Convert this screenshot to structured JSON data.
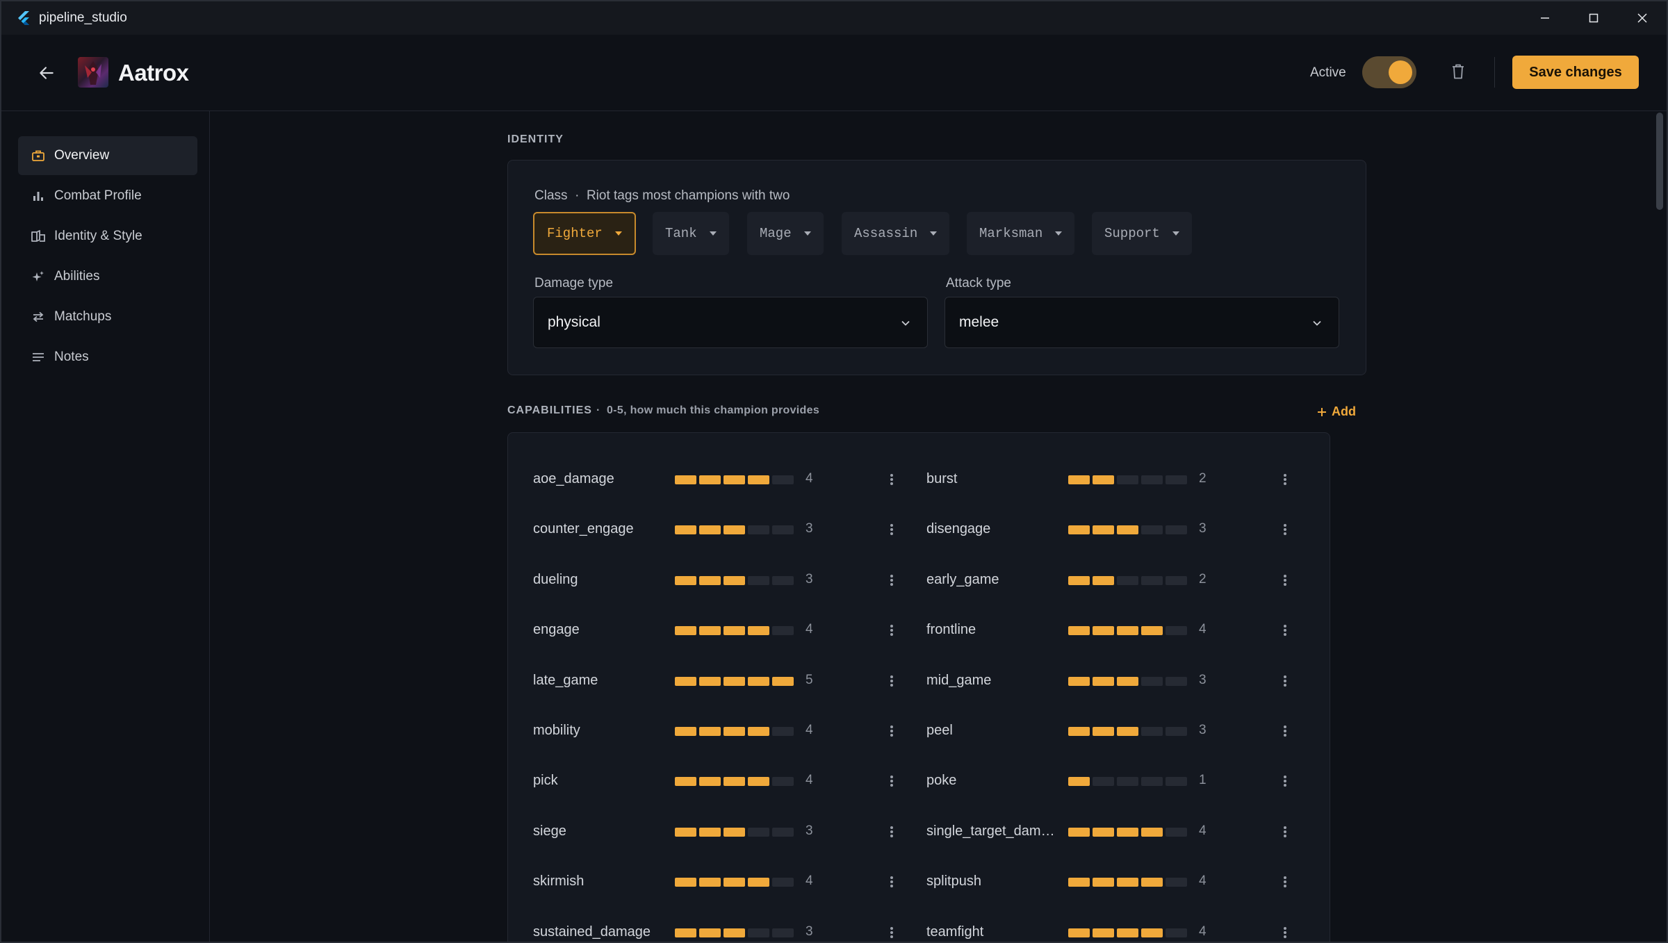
{
  "window": {
    "title": "pipeline_studio"
  },
  "header": {
    "champion_name": "Aatrox",
    "active_label": "Active",
    "active": true,
    "save_label": "Save changes"
  },
  "sidebar": {
    "items": [
      {
        "label": "Overview",
        "icon": "briefcase-icon",
        "active": true
      },
      {
        "label": "Combat Profile",
        "icon": "bar-chart-icon",
        "active": false
      },
      {
        "label": "Identity & Style",
        "icon": "book-icon",
        "active": false
      },
      {
        "label": "Abilities",
        "icon": "sparkles-icon",
        "active": false
      },
      {
        "label": "Matchups",
        "icon": "swap-icon",
        "active": false
      },
      {
        "label": "Notes",
        "icon": "lines-icon",
        "active": false
      }
    ]
  },
  "identity": {
    "section_label": "IDENTITY",
    "class_caption": "Class  ·  Riot tags most champions with two",
    "classes": [
      {
        "label": "Fighter",
        "selected": true
      },
      {
        "label": "Tank",
        "selected": false
      },
      {
        "label": "Mage",
        "selected": false
      },
      {
        "label": "Assassin",
        "selected": false
      },
      {
        "label": "Marksman",
        "selected": false
      },
      {
        "label": "Support",
        "selected": false
      }
    ],
    "damage_type_label": "Damage type",
    "damage_type_value": "physical",
    "attack_type_label": "Attack type",
    "attack_type_value": "melee"
  },
  "capabilities": {
    "section_label": "CAPABILITIES",
    "section_sub": "·  0-5, how much this champion provides",
    "add_label": "Add",
    "max": 5,
    "items": [
      {
        "name": "aoe_damage",
        "value": 4
      },
      {
        "name": "burst",
        "value": 2
      },
      {
        "name": "counter_engage",
        "value": 3
      },
      {
        "name": "disengage",
        "value": 3
      },
      {
        "name": "dueling",
        "value": 3
      },
      {
        "name": "early_game",
        "value": 2
      },
      {
        "name": "engage",
        "value": 4
      },
      {
        "name": "frontline",
        "value": 4
      },
      {
        "name": "late_game",
        "value": 5
      },
      {
        "name": "mid_game",
        "value": 3
      },
      {
        "name": "mobility",
        "value": 4
      },
      {
        "name": "peel",
        "value": 3
      },
      {
        "name": "pick",
        "value": 4
      },
      {
        "name": "poke",
        "value": 1
      },
      {
        "name": "siege",
        "value": 3
      },
      {
        "name": "single_target_dama...",
        "value": 4
      },
      {
        "name": "skirmish",
        "value": 4
      },
      {
        "name": "splitpush",
        "value": 4
      },
      {
        "name": "sustained_damage",
        "value": 3
      },
      {
        "name": "teamfight",
        "value": 4
      }
    ]
  },
  "colors": {
    "accent": "#f0a93b",
    "background": "#0e1117",
    "card": "#141820"
  }
}
